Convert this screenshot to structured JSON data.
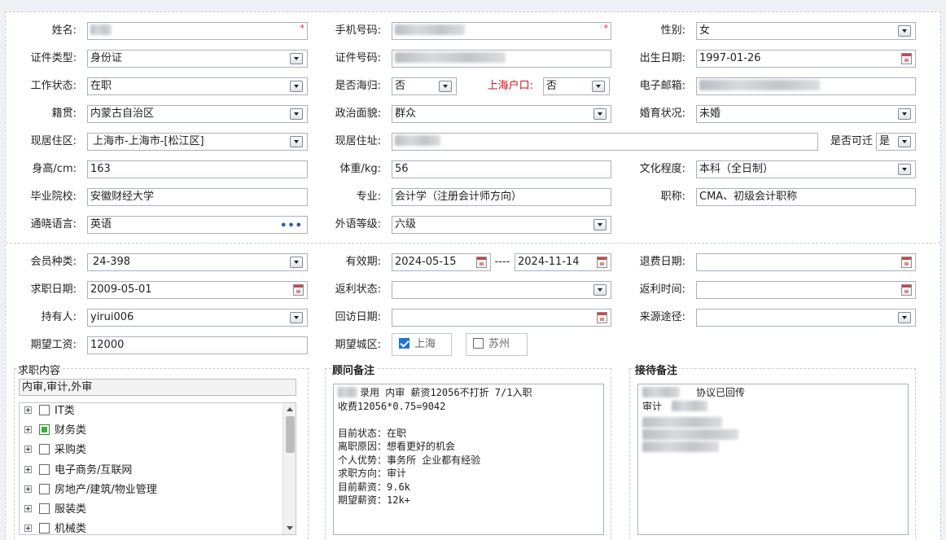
{
  "personal": {
    "name_label": "姓名:",
    "phone_label": "手机号码:",
    "gender_label": "性别:",
    "gender_value": "女",
    "idtype_label": "证件类型:",
    "idtype_value": "身份证",
    "idno_label": "证件号码:",
    "birth_label": "出生日期:",
    "birth_value": "1997-01-26",
    "workstatus_label": "工作状态:",
    "workstatus_value": "在职",
    "returnee_label": "是否海归:",
    "returnee_value": "否",
    "shanghai_hukou_label": "上海户口:",
    "shanghai_hukou_value": "否",
    "email_label": "电子邮箱:",
    "origin_label": "籍贯:",
    "origin_value": "内蒙古自治区",
    "political_label": "政治面貌:",
    "political_value": "群众",
    "marital_label": "婚育状况:",
    "marital_value": "未婚",
    "residence_label": "现居住区:",
    "residence_value": "上海市-上海市-[松江区]",
    "address_label": "现居住址:",
    "relocate_label": "是否可迁",
    "relocate_value": "是",
    "height_label": "身高/cm:",
    "height_value": "163",
    "weight_label": "体重/kg:",
    "weight_value": "56",
    "education_label": "文化程度:",
    "education_value": "本科（全日制）",
    "school_label": "毕业院校:",
    "school_value": "安徽财经大学",
    "major_label": "专业:",
    "major_value": "会计学（注册会计师方向）",
    "title_label": "职称:",
    "title_value": "CMA、初级会计职称",
    "language_label": "通晓语言:",
    "language_value": "英语",
    "language_more": "•••",
    "foreign_level_label": "外语等级:",
    "foreign_level_value": "六级",
    "required_mark": "*"
  },
  "membership": {
    "member_type_label": "会员种类:",
    "member_type_value": "24-398",
    "validity_label": "有效期:",
    "validity_start": "2024-05-15",
    "validity_sep": "----",
    "validity_end": "2024-11-14",
    "refund_date_label": "退费日期:",
    "jobseek_date_label": "求职日期:",
    "jobseek_date_value": "2009-05-01",
    "rebate_status_label": "返利状态:",
    "rebate_time_label": "返利时间:",
    "holder_label": "持有人:",
    "holder_value": "yirui006",
    "revisit_label": "回访日期:",
    "source_label": "来源途径:",
    "salary_label": "期望工资:",
    "salary_value": "12000",
    "city_label": "期望城区:",
    "city_shanghai": "上海",
    "city_suzhou": "苏州"
  },
  "job_content": {
    "title": "求职内容",
    "summary": "内审,审计,外审",
    "tree": [
      "IT类",
      "财务类",
      "采购类",
      "电子商务/互联网",
      "房地产/建筑/物业管理",
      "服装类",
      "机械类"
    ]
  },
  "consultant": {
    "title": "顾问备注",
    "lines": [
      "录用 内审 薪资12056不打折 7/1入职",
      "收费12056*0.75=9042",
      "",
      "目前状态：在职",
      "离职原因：想看更好的机会",
      "个人优势：事务所 企业都有经验",
      "求职方向：审计",
      "目前薪资：9.6k",
      "期望薪资：12k+"
    ]
  },
  "reception": {
    "title": "接待备注",
    "line1": "协议已回传",
    "line2": "审计"
  },
  "colors": {
    "accent": "#1f74d6",
    "required": "#e02020",
    "hukou_label": "#d0101b"
  }
}
